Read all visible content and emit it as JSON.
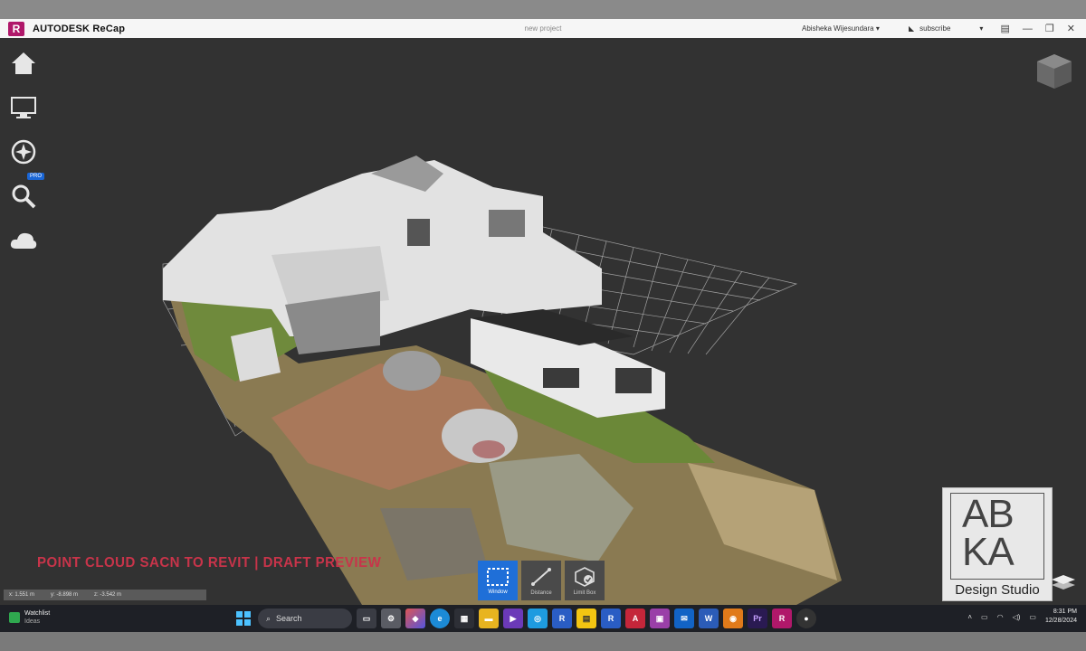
{
  "app": {
    "brand": "AUTODESK ReCap",
    "logo_letter": "R",
    "project_title": "new project",
    "user_name": "Abisheka Wijesundara",
    "subscribe_label": "subscribe"
  },
  "sidebar": {
    "items": [
      {
        "name": "home"
      },
      {
        "name": "display"
      },
      {
        "name": "navigate"
      },
      {
        "name": "search",
        "badge": "PRO"
      },
      {
        "name": "cloud"
      }
    ]
  },
  "overlay": {
    "watermark": "POINT CLOUD SACN TO REVIT | DRAFT PREVIEW"
  },
  "coords": {
    "x": "x: 1.551 m",
    "y": "y: -8.898 m",
    "z": "z: -3.542 m"
  },
  "tools": [
    {
      "label": "Window",
      "icon": "window-select-icon",
      "active": true
    },
    {
      "label": "Distance",
      "icon": "distance-icon",
      "active": false
    },
    {
      "label": "Limit Box",
      "icon": "limit-box-icon",
      "active": false
    }
  ],
  "logo_card": {
    "letters_top": "AB",
    "letters_bottom": "KA",
    "studio": "Design Studio"
  },
  "taskbar": {
    "widget_title": "Watchlist",
    "widget_sub": "Ideas",
    "search_placeholder": "Search",
    "time": "8:31 PM",
    "date": "12/28/2024"
  },
  "colors": {
    "accent": "#1f6fd8",
    "recap_brand": "#b0186a",
    "watermark": "#c8344a"
  }
}
